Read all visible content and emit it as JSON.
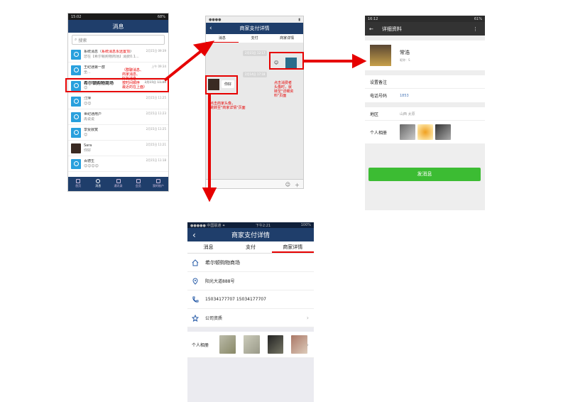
{
  "phone1": {
    "status_time": "15:02",
    "status_right": "68%",
    "title": "消息",
    "search_placeholder": "搜索",
    "rows": [
      {
        "name": "系统消息（",
        "name_red": "系统消息永远置顶",
        "name_end": "）",
        "sub": "您在【希尔顿购物商场】消费0.1...",
        "time": "2月15日 09:39"
      },
      {
        "name": "王纪通第一群",
        "sub": "坐...",
        "time": "上午 09:34"
      },
      {
        "name": "希尔顿购物商场",
        "sub": "😊",
        "time": "2月15日 11:40"
      },
      {
        "name": "汀萍",
        "sub": "😊😊",
        "time": "2月15日 11:25"
      },
      {
        "name": "世纪通用户",
        "sub": "再说说",
        "time": "2月15日 11:23"
      },
      {
        "name": "享受寂寞",
        "sub": "😊",
        "time": "2月15日 11:25"
      },
      {
        "name": "Sara",
        "sub": "你好",
        "time": "2月15日 11:21"
      },
      {
        "name": "百德生",
        "sub": "😊😊😊😊",
        "time": "2月15日 11:18"
      }
    ],
    "tabs": [
      "首页",
      "消息",
      "通讯录",
      "会员",
      "我的账户"
    ],
    "note": "（群聊消息、\n商家消息、\n好友消息\n按时间顺序\n最近的在上面）"
  },
  "phone2": {
    "title": "商家支付详情",
    "segs": [
      "消息",
      "支付",
      "商家详情"
    ],
    "time_bubble1": "2月15日 12:17",
    "time_bubble2": "2月14日 17:18",
    "bubble_text": "你好",
    "note_left": "点击商家头像，\n跳转至\"商家详情\"页面",
    "note_right": "点击消费者\n头像时，就\n转至\"详细资\n料\"页面"
  },
  "phone3": {
    "status_time": "16:12",
    "status_right": "61%",
    "title": "详细资料",
    "name": "常浩",
    "nickname": "昵称：S",
    "remark_label": "设置备注",
    "phone_label": "电话号码",
    "phone_value": "1853",
    "region_label": "地区",
    "region_value": "山西  太原",
    "album_label": "个人相册",
    "send_label": "发消息"
  },
  "phone4": {
    "status_left": "●●●●● 中国联通 ✦",
    "status_time": "下午2:21",
    "status_right": "100%",
    "title": "商家支付详情",
    "segs": [
      "消息",
      "支付",
      "商家详情"
    ],
    "shop_name": "希尔顿购物商场",
    "address": "阳光大道888号",
    "phones": "15034177707  15034177707",
    "qualification": "公司资质",
    "album_label": "个人相册"
  },
  "colors": {
    "nav": "#1f3e6b",
    "accent": "#e60000",
    "send": "#3cbc33"
  }
}
